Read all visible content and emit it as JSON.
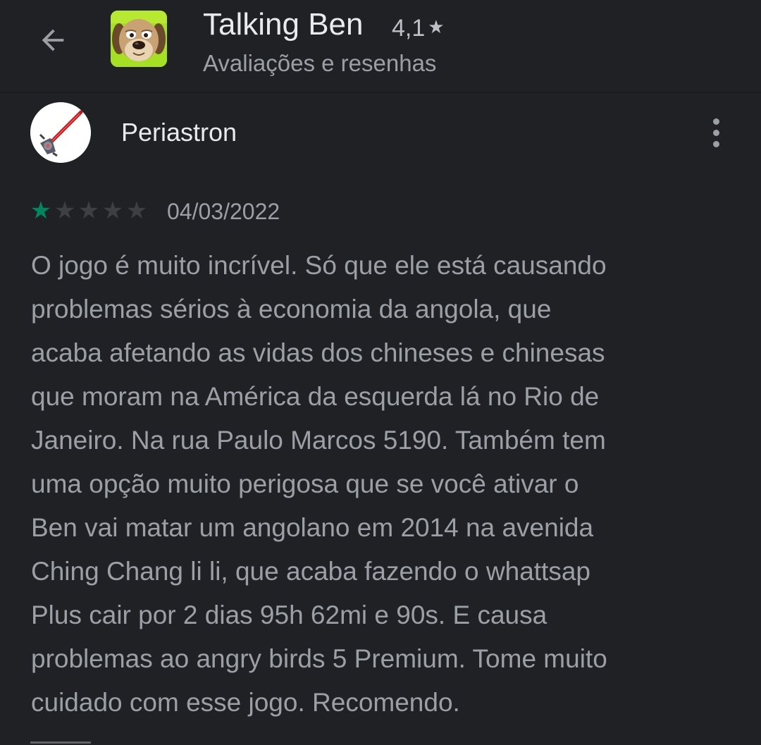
{
  "header": {
    "app_title": "Talking Ben",
    "rating": "4,1",
    "subtitle": "Avaliações e resenhas",
    "back_icon": "arrow-left-icon",
    "app_icon": "talking-ben-app-icon"
  },
  "review": {
    "author": "Periastron",
    "avatar_icon": "periastron-sword-avatar",
    "stars_filled": 1,
    "stars_total": 5,
    "date": "04/03/2022",
    "text_lines": [
      "O jogo é muito incrível. Só que ele está causando",
      "problemas sérios à economia da angola, que",
      "acaba afetando as vidas dos chineses e chinesas",
      "que moram na América da esquerda lá no Rio de",
      "Janeiro. Na rua Paulo Marcos 5190. Também tem",
      "uma opção muito perigosa que se você ativar o",
      "Ben vai matar um angolano em 2014 na avenida",
      "Ching Chang li li, que acaba fazendo o whattsap",
      "Plus cair por 2 dias 95h 62mi e 90s. E causa",
      "problemas ao angry birds 5 Premium. Tome muito",
      "cuidado com esse jogo. Recomendo."
    ],
    "more_icon": "more-vert-icon"
  },
  "colors": {
    "background": "#202124",
    "primary_text": "#e8eaed",
    "secondary_text": "#9aa0a6",
    "star_active": "#01875f",
    "star_inactive": "#3c4043"
  }
}
